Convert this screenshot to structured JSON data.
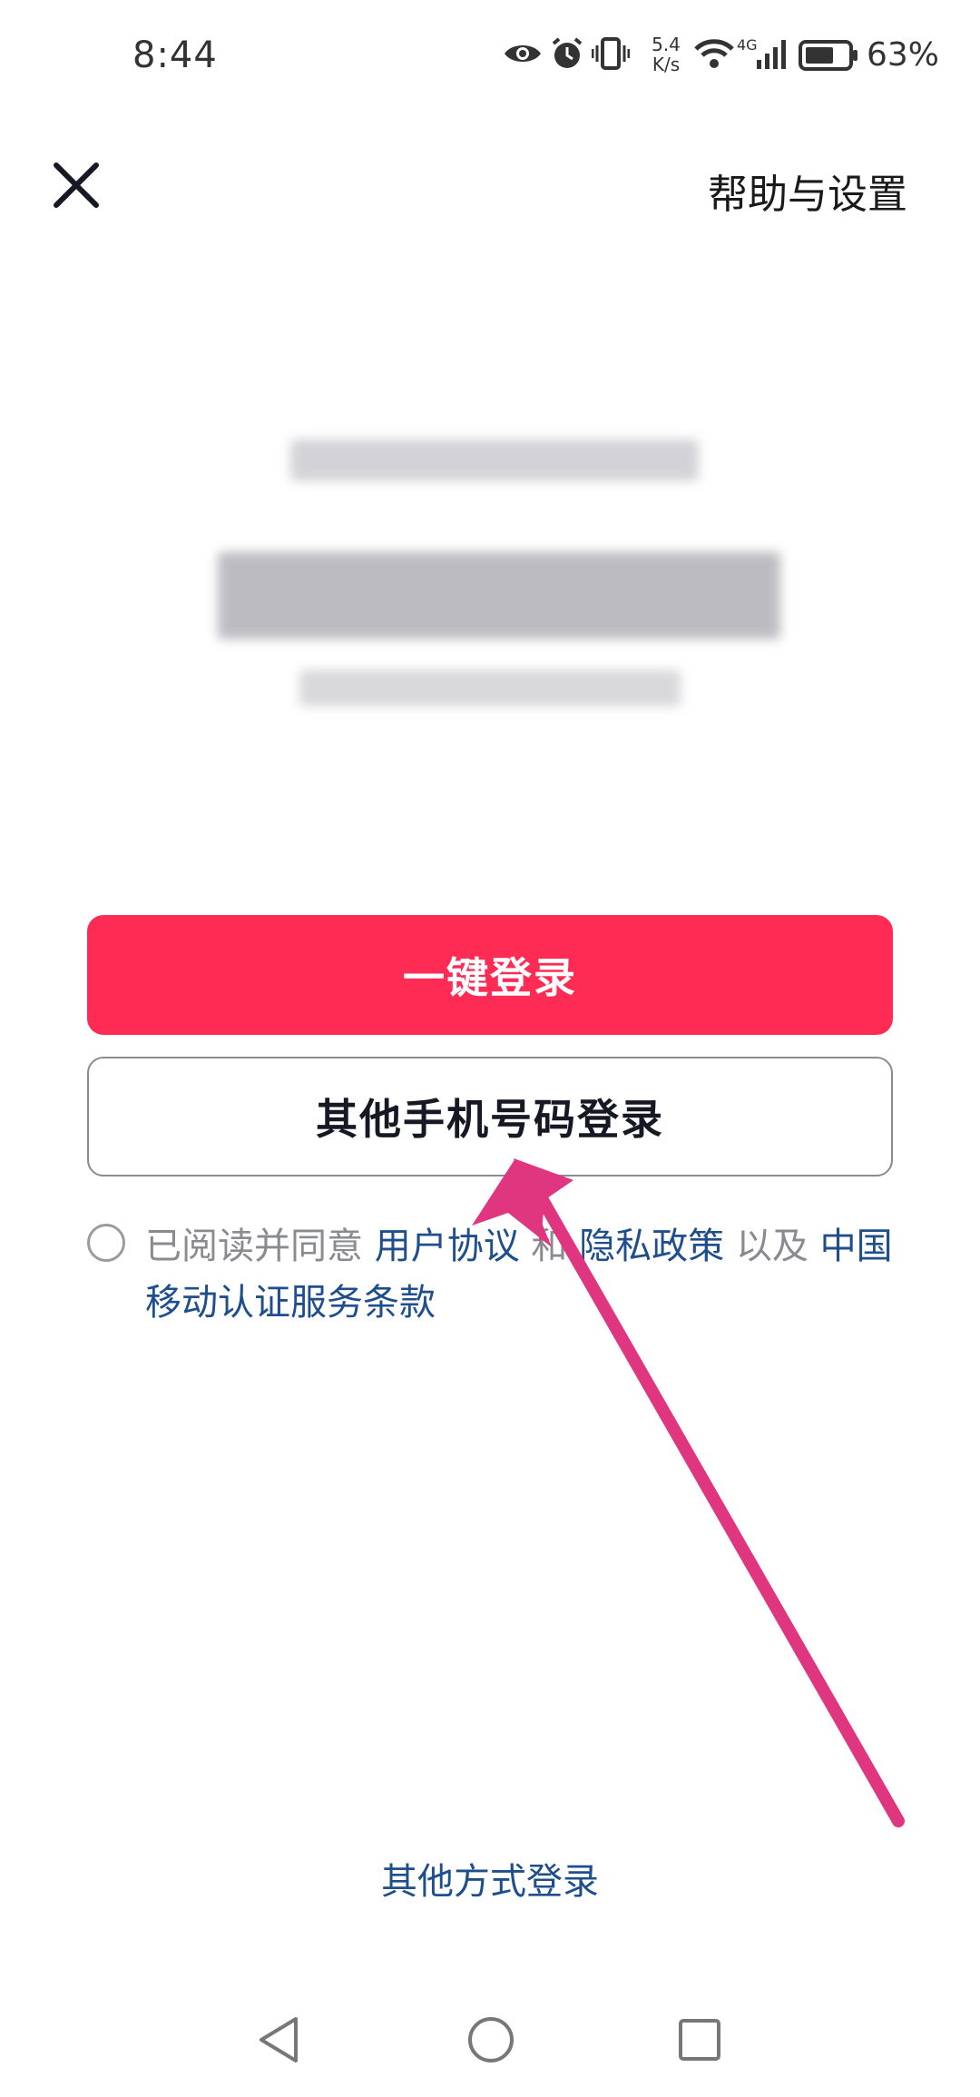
{
  "status_bar": {
    "time": "8:44",
    "net_speed_value": "5.4",
    "net_speed_unit": "K/s",
    "network_type": "4G",
    "battery_percent": "63%"
  },
  "header": {
    "help_settings_label": "帮助与设置"
  },
  "buttons": {
    "one_click_login": "一键登录",
    "other_phone_login": "其他手机号码登录"
  },
  "agreement": {
    "prefix": "已阅读并同意 ",
    "user_agreement": "用户协议",
    "and": " 和 ",
    "privacy_policy": "隐私政策",
    "as_well_as": " 以及 ",
    "carrier_terms": "中国移动认证服务条款"
  },
  "footer": {
    "other_method_login": "其他方式登录"
  },
  "colors": {
    "accent": "#fe2c55",
    "link": "#1f4e8c",
    "annotation_arrow": "#e0357f"
  }
}
